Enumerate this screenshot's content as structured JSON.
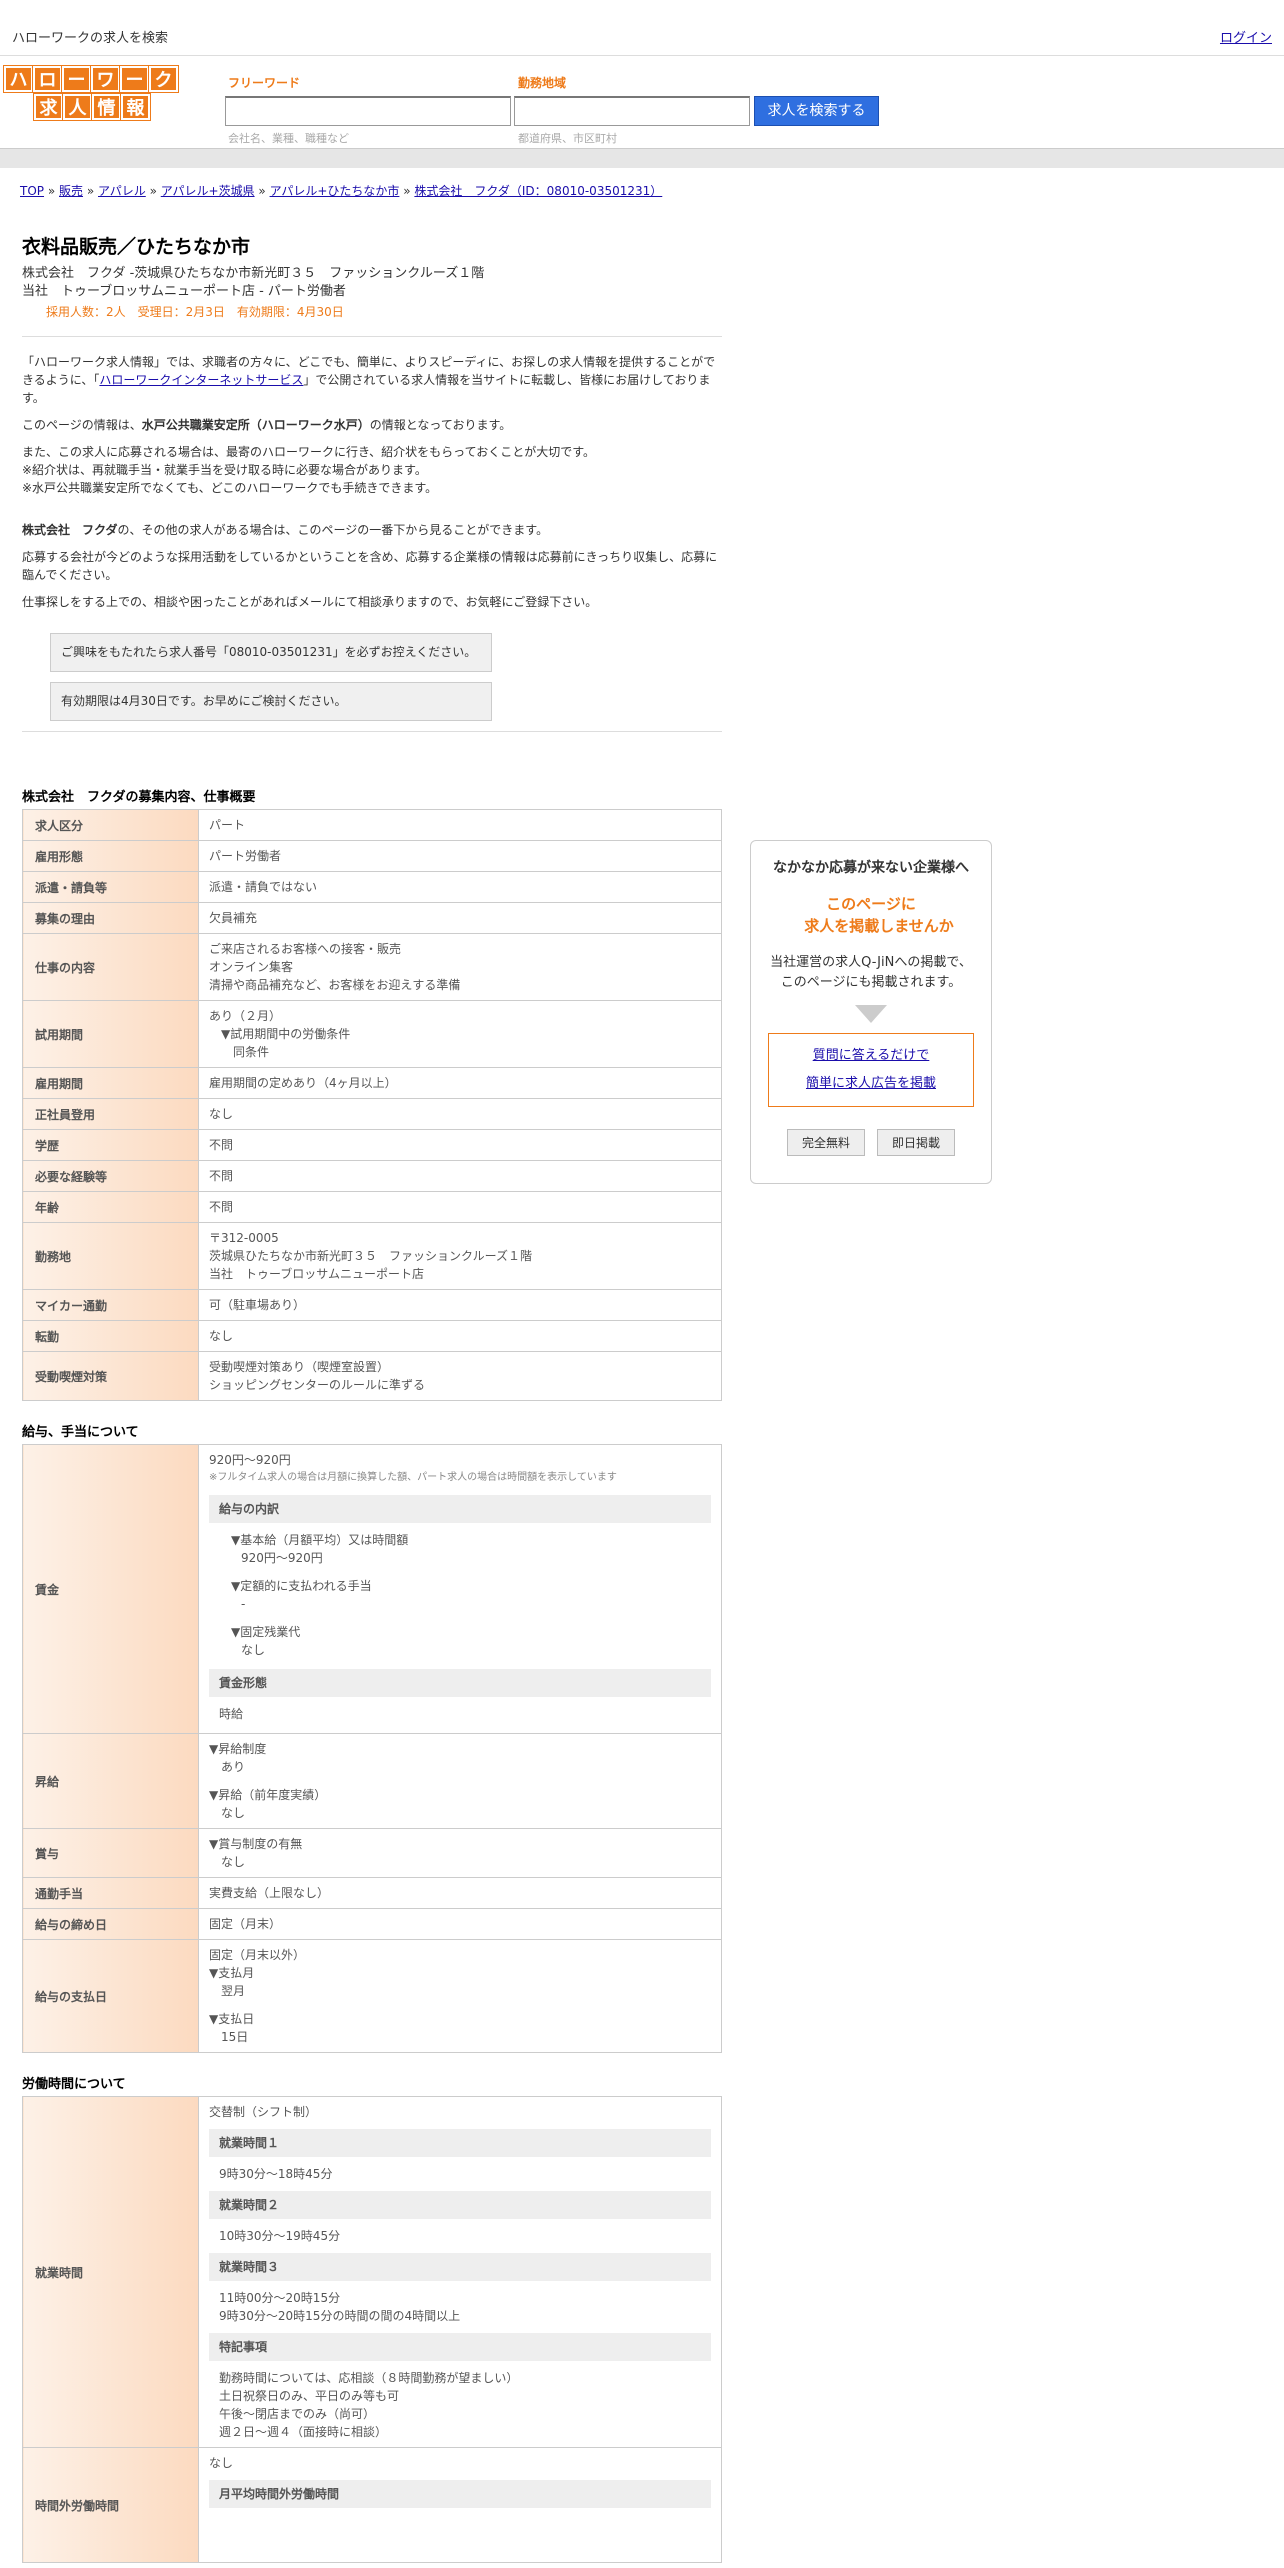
{
  "topbar": {
    "site_title": "ハローワークの求人を検索",
    "login": "ログイン"
  },
  "logo": {
    "row1": [
      "ハ",
      "ロ",
      "ー",
      "ワ",
      "ー",
      "ク"
    ],
    "row2": [
      "求",
      "人",
      "情",
      "報"
    ]
  },
  "search": {
    "keyword_label": "フリーワード",
    "keyword_hint": "会社名、業種、職種など",
    "area_label": "勤務地域",
    "area_hint": "都道府県、市区町村",
    "button": "求人を検索する"
  },
  "breadcrumb": [
    {
      "label": "TOP"
    },
    {
      "label": "販売"
    },
    {
      "label": "アパレル"
    },
    {
      "label": "アパレル+茨城県"
    },
    {
      "label": "アパレル+ひたちなか市"
    },
    {
      "label": "株式会社　フクダ（ID：08010-03501231）"
    }
  ],
  "job": {
    "title": "衣料品販売／ひたちなか市",
    "company_line": "株式会社　フクダ -茨城県ひたちなか市新光町３５　ファッションクルーズ１階",
    "store_line": "当社　トゥーブロッサムニューポート店 - パート労働者",
    "meta": "採用人数：2人　受理日：2月3日　有効期限：4月30日"
  },
  "intro": {
    "p1a": "「ハローワーク求人情報」では、求職者の方々に、どこでも、簡単に、よりスピーディに、お探しの求人情報を提供することができるように、「",
    "p1link": "ハローワークインターネットサービス",
    "p1b": "」で公開されている求人情報を当サイトに転載し、皆様にお届けしております。",
    "p2a": "このページの情報は、",
    "p2b": "水戸公共職業安定所（ハローワーク水戸）",
    "p2c": "の情報となっております。",
    "p3": "また、この求人に応募される場合は、最寄のハローワークに行き、紹介状をもらっておくことが大切です。",
    "p3b": "※紹介状は、再就職手当・就業手当を受け取る時に必要な場合があります。",
    "p3c": "※水戸公共職業安定所でなくても、どこのハローワークでも手続きできます。",
    "p4a": "株式会社　フクダ",
    "p4b": "の、その他の求人がある場合は、このページの一番下から見ることができます。",
    "p5": "応募する会社が今どのような採用活動をしているかということを含め、応募する企業様の情報は応募前にきっちり収集し、応募に臨んでください。",
    "p6": "仕事探しをする上での、相談や困ったことがあればメールにて相談承りますので、お気軽にご登録下さい。",
    "note1": "ご興味をもたれたら求人番号「08010-03501231」を必ずお控えください。",
    "note2": "有効期限は4月30日です。お早めにご検討ください。"
  },
  "sec1": {
    "heading": "株式会社　フクダの募集内容、仕事概要",
    "rows": [
      {
        "k": "求人区分",
        "v": [
          "パート"
        ]
      },
      {
        "k": "雇用形態",
        "v": [
          "パート労働者"
        ]
      },
      {
        "k": "派遣・請負等",
        "v": [
          "派遣・請負ではない"
        ]
      },
      {
        "k": "募集の理由",
        "v": [
          "欠員補充"
        ]
      },
      {
        "k": "仕事の内容",
        "v": [
          "ご来店されるお客様への接客・販売",
          "オンライン集客",
          "清掃や商品補充など、お客様をお迎えする準備"
        ]
      },
      {
        "k": "試用期間",
        "v": [
          "あり（２月）",
          "　▼試用期間中の労働条件",
          "　　同条件"
        ]
      },
      {
        "k": "雇用期間",
        "v": [
          "雇用期間の定めあり（4ヶ月以上）"
        ]
      },
      {
        "k": "正社員登用",
        "v": [
          "なし"
        ]
      },
      {
        "k": "学歴",
        "v": [
          "不問"
        ]
      },
      {
        "k": "必要な経験等",
        "v": [
          "不問"
        ]
      },
      {
        "k": "年齢",
        "v": [
          "不問"
        ]
      },
      {
        "k": "勤務地",
        "v": [
          "〒312-0005",
          "茨城県ひたちなか市新光町３５　ファッションクルーズ１階",
          "当社　トゥーブロッサムニューポート店"
        ]
      },
      {
        "k": "マイカー通勤",
        "v": [
          "可（駐車場あり）"
        ]
      },
      {
        "k": "転勤",
        "v": [
          "なし"
        ]
      },
      {
        "k": "受動喫煙対策",
        "v": [
          "受動喫煙対策あり（喫煙室設置）",
          "ショッピングセンターのルールに準ずる"
        ]
      }
    ]
  },
  "sec2": {
    "heading": "給与、手当について",
    "wage_label": "賃金",
    "wage_range": "920円〜920円",
    "wage_note": "※フルタイム求人の場合は月額に換算した額、パート求人の場合は時間額を表示しています",
    "breakdown_title": "給与の内訳",
    "b1": "▼基本給（月額平均）又は時間額",
    "b1v": "920円〜920円",
    "b2": "▼定額的に支払われる手当",
    "b2v": "-",
    "b3": "▼固定残業代",
    "b3v": "なし",
    "form_title": "賃金形態",
    "form_v": "時給",
    "raise_label": "昇給",
    "r1": "▼昇給制度",
    "r1v": "あり",
    "r2": "▼昇給（前年度実績）",
    "r2v": "なし",
    "bonus_label": "賞与",
    "bo1": "▼賞与制度の有無",
    "bo1v": "なし",
    "commute_label": "通勤手当",
    "commute_v": "実費支給（上限なし）",
    "close_label": "給与の締め日",
    "close_v": "固定（月末）",
    "pay_label": "給与の支払日",
    "p1": "固定（月末以外）",
    "p2": "▼支払月",
    "p2v": "翌月",
    "p3": "▼支払日",
    "p3v": "15日"
  },
  "sec3": {
    "heading": "労働時間について",
    "hours_label": "就業時間",
    "shift": "交替制（シフト制）",
    "t1": "就業時間１",
    "t1v": "9時30分〜18時45分",
    "t2": "就業時間２",
    "t2v": "10時30分〜19時45分",
    "t3": "就業時間３",
    "t3v1": "11時00分〜20時15分",
    "t3v2": "9時30分〜20時15分の時間の間の4時間以上",
    "sp": "特記事項",
    "sp1": "勤務時間については、応相談（８時間勤務が望ましい）",
    "sp2": "土日祝祭日のみ、平日のみ等も可",
    "sp3": "午後～閉店までのみ（尚可）",
    "sp4": "週２日～週４（面接時に相談）",
    "ot_label": "時間外労働時間",
    "ot_v": "なし",
    "ot_sub": "月平均時間外労働時間"
  },
  "side": {
    "t1": "なかなか応募が来ない企業様へ",
    "t2a": "このページに",
    "t2b": "求人を掲載しませんか",
    "t3a": "当社運営の求人Q-JiNへの掲載で、",
    "t3b": "このページにも掲載されます。",
    "link1": "質問に答えるだけで",
    "link2": "簡単に求人広告を掲載",
    "btn1": "完全無料",
    "btn2": "即日掲載"
  }
}
